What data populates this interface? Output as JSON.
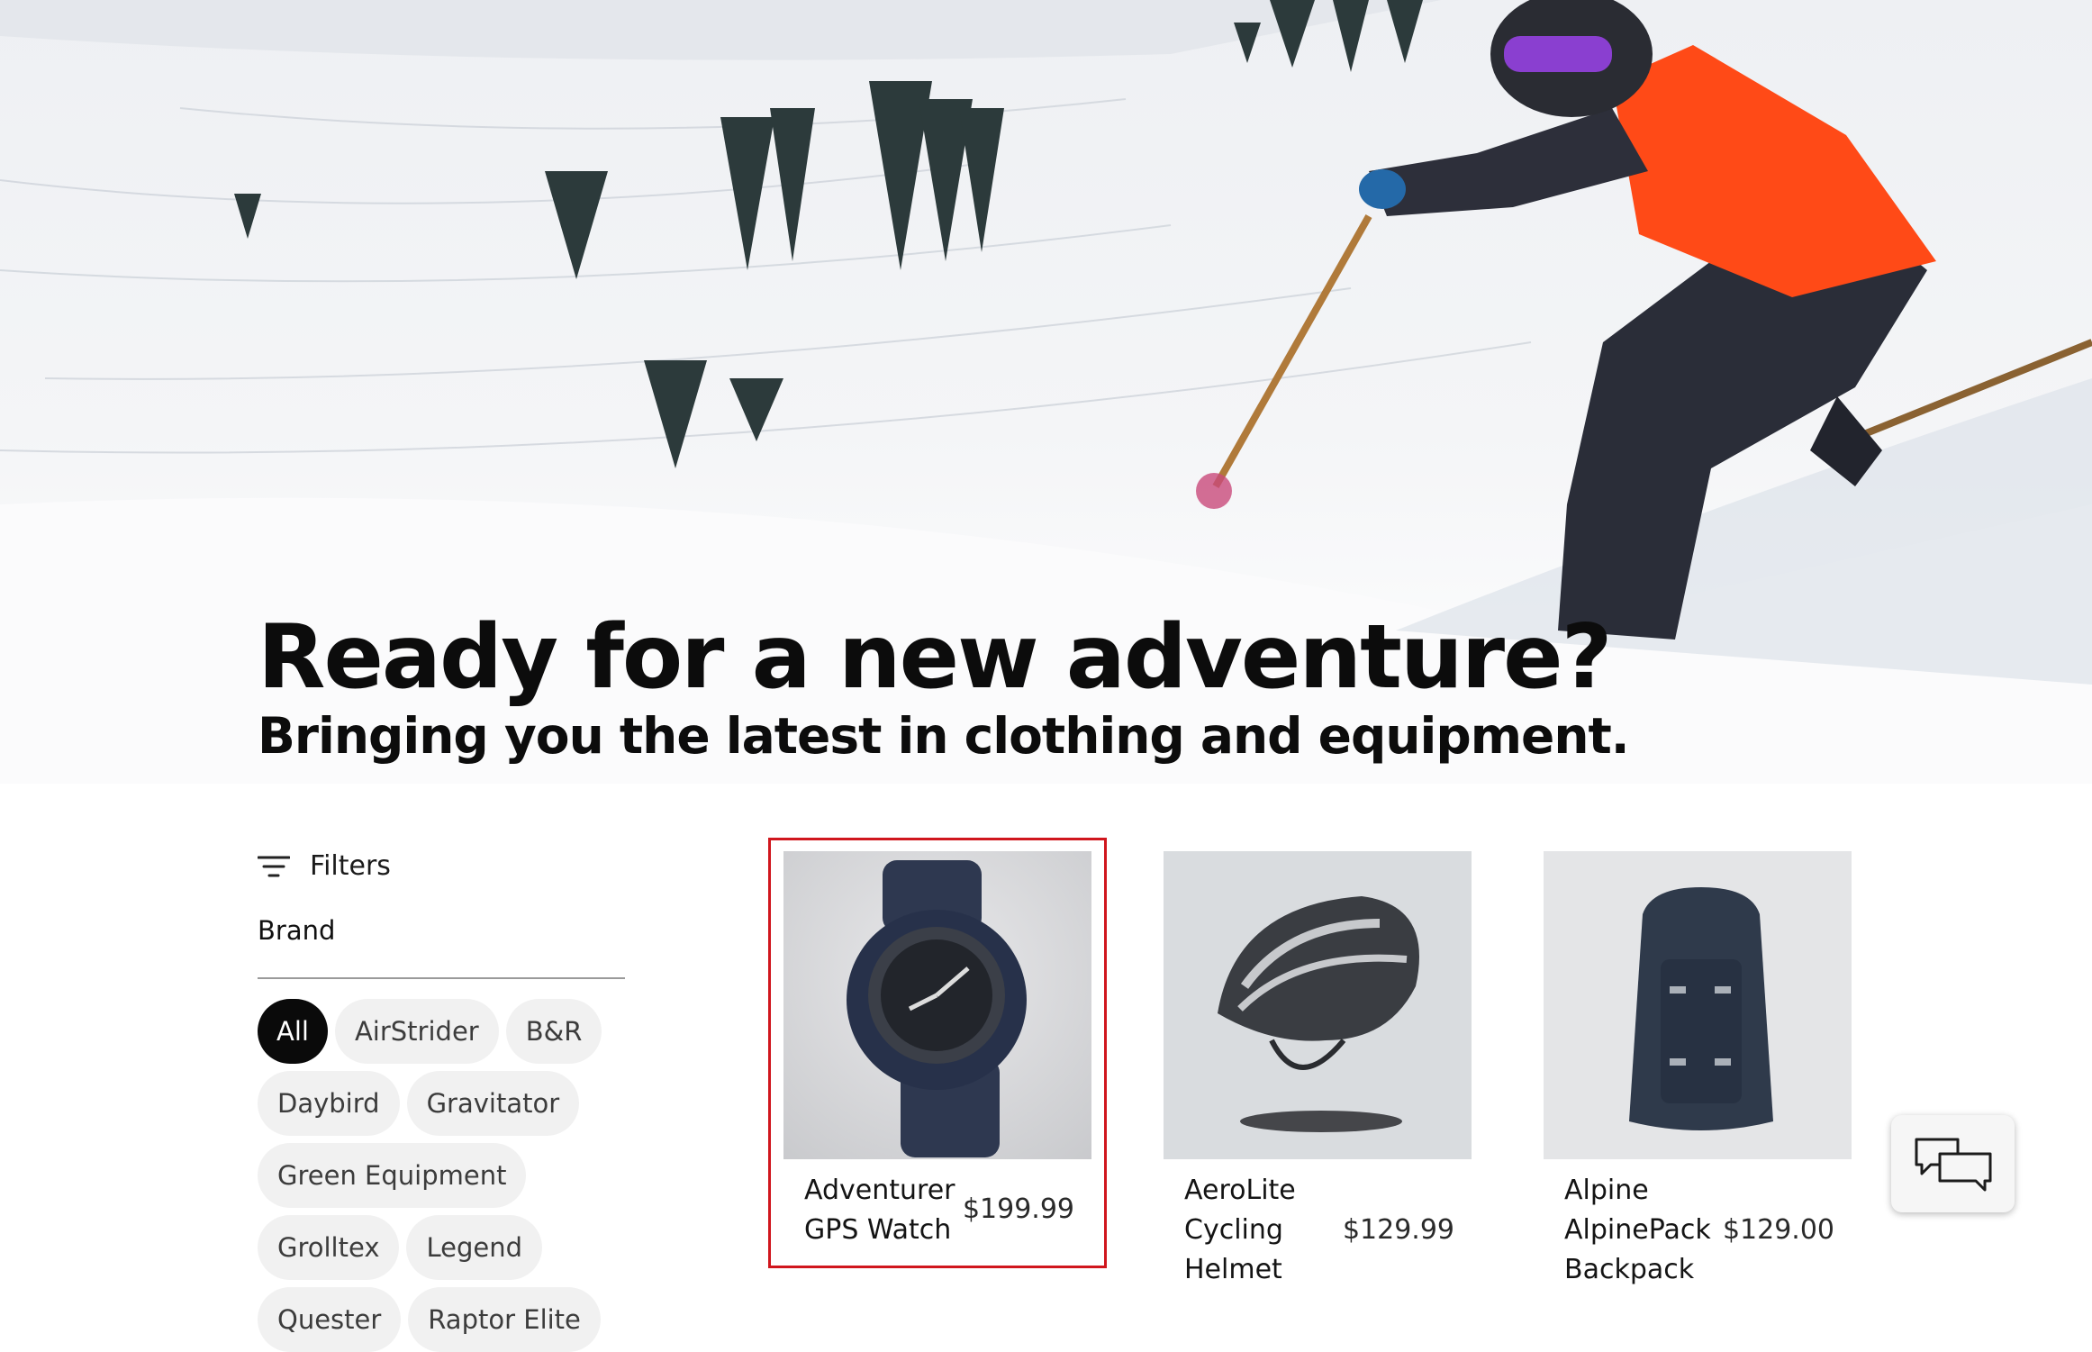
{
  "hero": {
    "title": "Ready for a new adventure?",
    "subtitle": "Bringing you the latest in clothing and equipment."
  },
  "filters": {
    "toggle_label": "Filters",
    "icon": "filter-lines-icon",
    "brand_heading": "Brand",
    "brands": [
      {
        "label": "All",
        "active": true
      },
      {
        "label": "AirStrider",
        "active": false
      },
      {
        "label": "B&R",
        "active": false
      },
      {
        "label": "Daybird",
        "active": false
      },
      {
        "label": "Gravitator",
        "active": false
      },
      {
        "label": "Green Equipment",
        "active": false
      },
      {
        "label": "Grolltex",
        "active": false
      },
      {
        "label": "Legend",
        "active": false
      },
      {
        "label": "Quester",
        "active": false
      },
      {
        "label": "Raptor Elite",
        "active": false
      }
    ]
  },
  "products": [
    {
      "name": "Adventurer GPS Watch",
      "price": "$199.99",
      "selected": true
    },
    {
      "name": "AeroLite Cycling Helmet",
      "price": "$129.99",
      "selected": false
    },
    {
      "name": "Alpine AlpinePack Backpack",
      "price": "$129.00",
      "selected": false
    }
  ],
  "chat": {
    "icon": "chat-bubbles-icon"
  },
  "colors": {
    "accent_selected": "#d0161d",
    "chip_active_bg": "#0a0a0a",
    "chip_bg": "#f1f1f1",
    "jacket": "#ff4a17"
  }
}
